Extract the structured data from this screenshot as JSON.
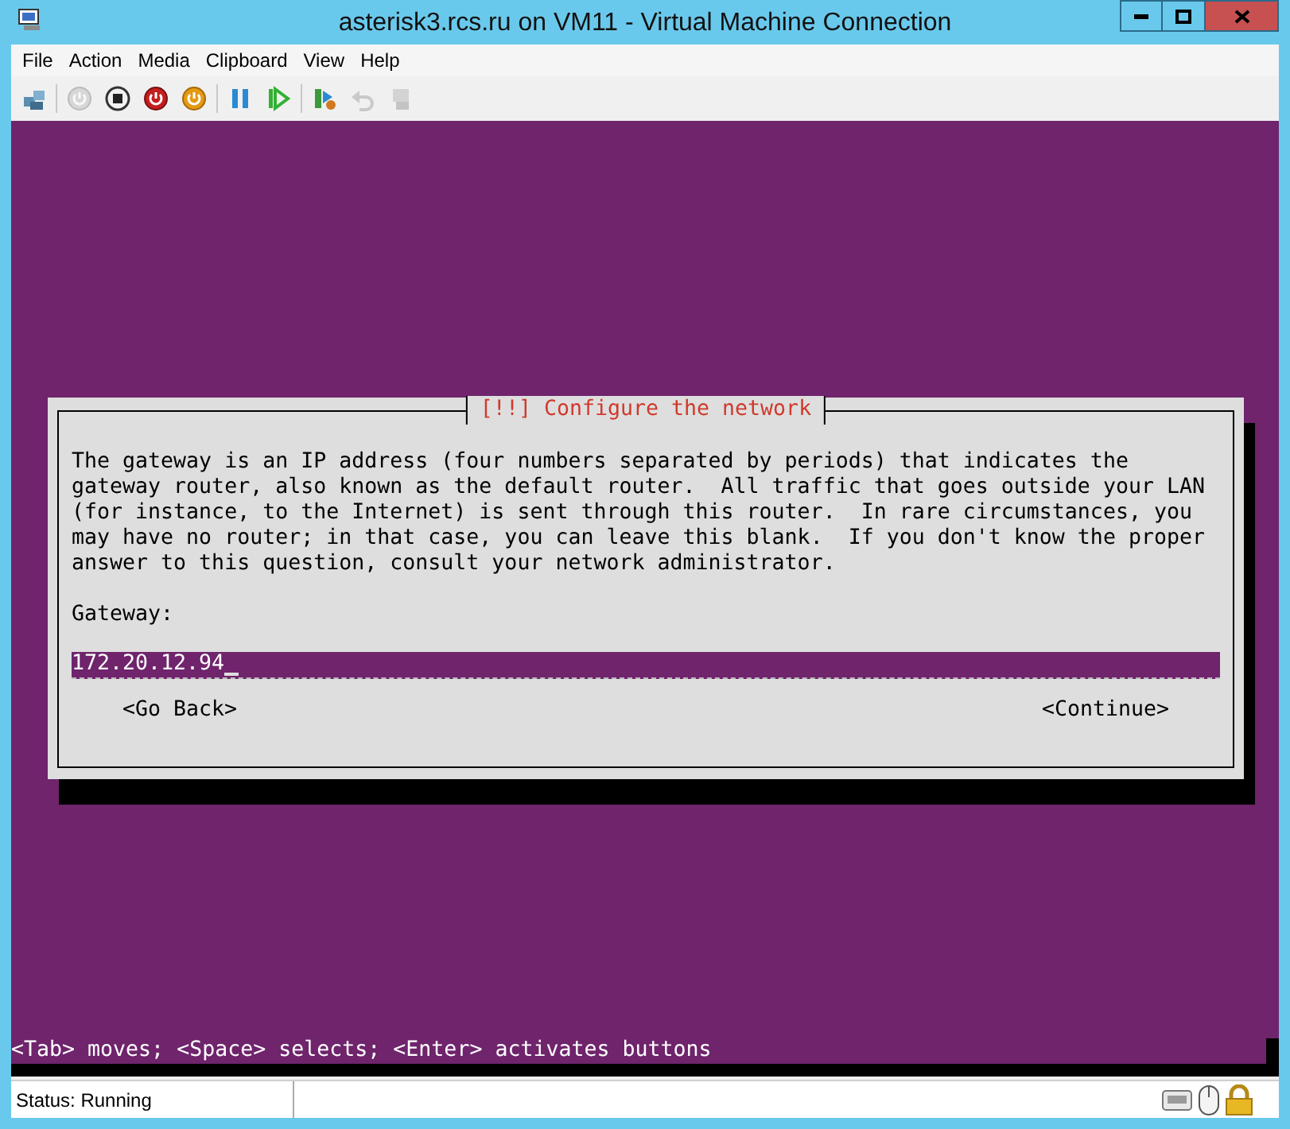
{
  "window": {
    "title": "asterisk3.rcs.ru on VM11 - Virtual Machine Connection"
  },
  "menu": [
    "File",
    "Action",
    "Media",
    "Clipboard",
    "View",
    "Help"
  ],
  "toolbar": [
    {
      "kind": "ctrl-alt-del",
      "disabled": false
    },
    {
      "kind": "start",
      "disabled": true
    },
    {
      "kind": "turn-off",
      "disabled": false
    },
    {
      "kind": "shut-down",
      "disabled": false
    },
    {
      "kind": "save",
      "disabled": false
    },
    {
      "kind": "pause",
      "disabled": false
    },
    {
      "kind": "reset",
      "disabled": false
    },
    {
      "kind": "checkpoint",
      "disabled": false
    },
    {
      "kind": "revert",
      "disabled": true
    },
    {
      "kind": "enhanced-session",
      "disabled": true
    }
  ],
  "dialog": {
    "title": "[!!] Configure the network",
    "lines": [
      "The gateway is an IP address (four numbers separated by periods) that indicates the",
      "gateway router, also known as the default router.  All traffic that goes outside your LAN",
      "(for instance, to the Internet) is sent through this router.  In rare circumstances, you",
      "may have no router; in that case, you can leave this blank.  If you don't know the proper",
      "answer to this question, consult your network administrator."
    ],
    "field_label": "Gateway:",
    "field_value": "172.20.12.94",
    "buttons": [
      "<Go Back>",
      "<Continue>"
    ]
  },
  "help_line": "<Tab> moves; <Space> selects; <Enter> activates buttons",
  "status_bar": {
    "status": "Status: Running"
  }
}
